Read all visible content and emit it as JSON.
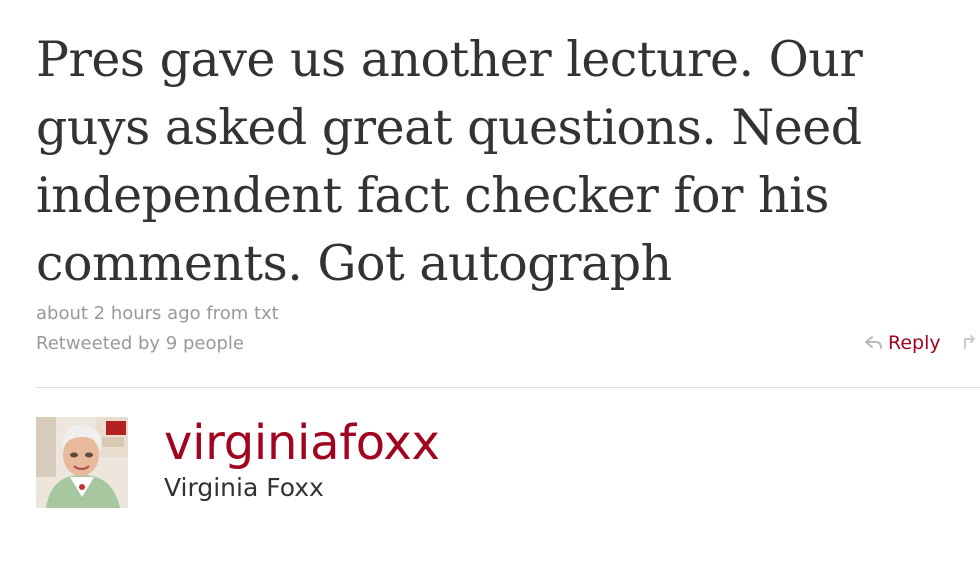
{
  "tweet": {
    "text": "Pres gave us another lecture. Our guys asked great questions. Need independent fact checker for his comments. Got autograph",
    "timestamp": "about 2 hours ago from txt",
    "retweet_info": "Retweeted by 9 people"
  },
  "actions": {
    "reply_label": "Reply",
    "reply_icon": "reply-arrow-icon",
    "retweet_icon": "retweet-icon"
  },
  "author": {
    "screen_name": "virginiafoxx",
    "full_name": "Virginia Foxx",
    "avatar_icon": "user-avatar"
  },
  "colors": {
    "link": "#a0041e",
    "tweet_text": "#333333",
    "meta_text": "#999999",
    "divider": "#dddddd"
  }
}
